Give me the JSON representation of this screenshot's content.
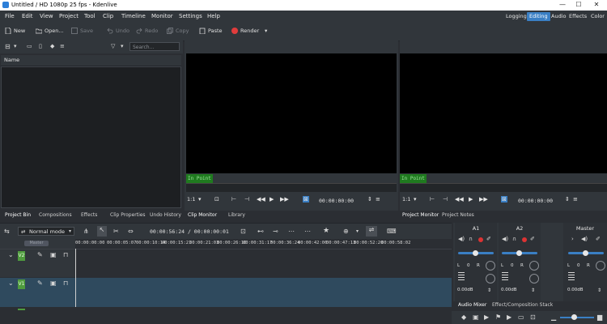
{
  "window": {
    "title": "Untitled / HD 1080p 25 fps - Kdenlive",
    "min": "—",
    "max": "☐",
    "close": "✕"
  },
  "menu": [
    "File",
    "Edit",
    "View",
    "Project",
    "Tool",
    "Clip",
    "Timeline",
    "Monitor",
    "Settings",
    "Help"
  ],
  "layouts": [
    "Logging",
    "Editing",
    "Audio",
    "Effects",
    "Color"
  ],
  "toolbar": {
    "new": "New",
    "open": "Open...",
    "save": "Save",
    "undo": "Undo",
    "redo": "Redo",
    "copy": "Copy",
    "paste": "Paste",
    "render": "Render"
  },
  "bin": {
    "search_placeholder": "Search...",
    "column_name": "Name"
  },
  "bin_tabs": [
    "Project Bin",
    "Compositions",
    "Effects",
    "Clip Properties",
    "Undo History"
  ],
  "clip_monitor": {
    "inpoint": "In Point",
    "zoom": "1:1",
    "timecode": "00:00:00:00",
    "tabs": [
      "Clip Monitor",
      "Library"
    ]
  },
  "project_monitor": {
    "inpoint": "In Point",
    "zoom": "1:1",
    "timecode": "00:00:00:00",
    "tabs": [
      "Project Monitor",
      "Project Notes"
    ]
  },
  "timeline": {
    "mode": "Normal mode",
    "position": "00:00:56:24 / 00:00:00:01",
    "master_label": "Master",
    "ruler": [
      "00:00:00:00",
      "00:00:05:07",
      "00:00:10:14",
      "00:00:15:21",
      "00:00:21:03",
      "00:00:26:10",
      "00:00:31:17",
      "00:00:36:24",
      "00:00:42:06",
      "00:00:47:13",
      "00:00:52:20",
      "00:00:58:02"
    ],
    "tracks": [
      {
        "badge": "V2"
      },
      {
        "badge": "V1"
      }
    ]
  },
  "mixer": {
    "strips": [
      {
        "label": "A1",
        "db": "0.00dB",
        "l": "L",
        "zero": "0",
        "r": "R"
      },
      {
        "label": "A2",
        "db": "0.00dB",
        "l": "L",
        "zero": "0",
        "r": "R"
      },
      {
        "label": "Master",
        "db": "0.00dB",
        "l": "L",
        "zero": "0",
        "r": "R"
      }
    ],
    "tabs": [
      "Audio Mixer",
      "Effect/Composition Stack"
    ]
  },
  "colors": {
    "accent": "#3a7fc4",
    "track_badge": "#4f9b3e",
    "inpoint": "#1f7a1f",
    "render": "#e03c3c"
  }
}
